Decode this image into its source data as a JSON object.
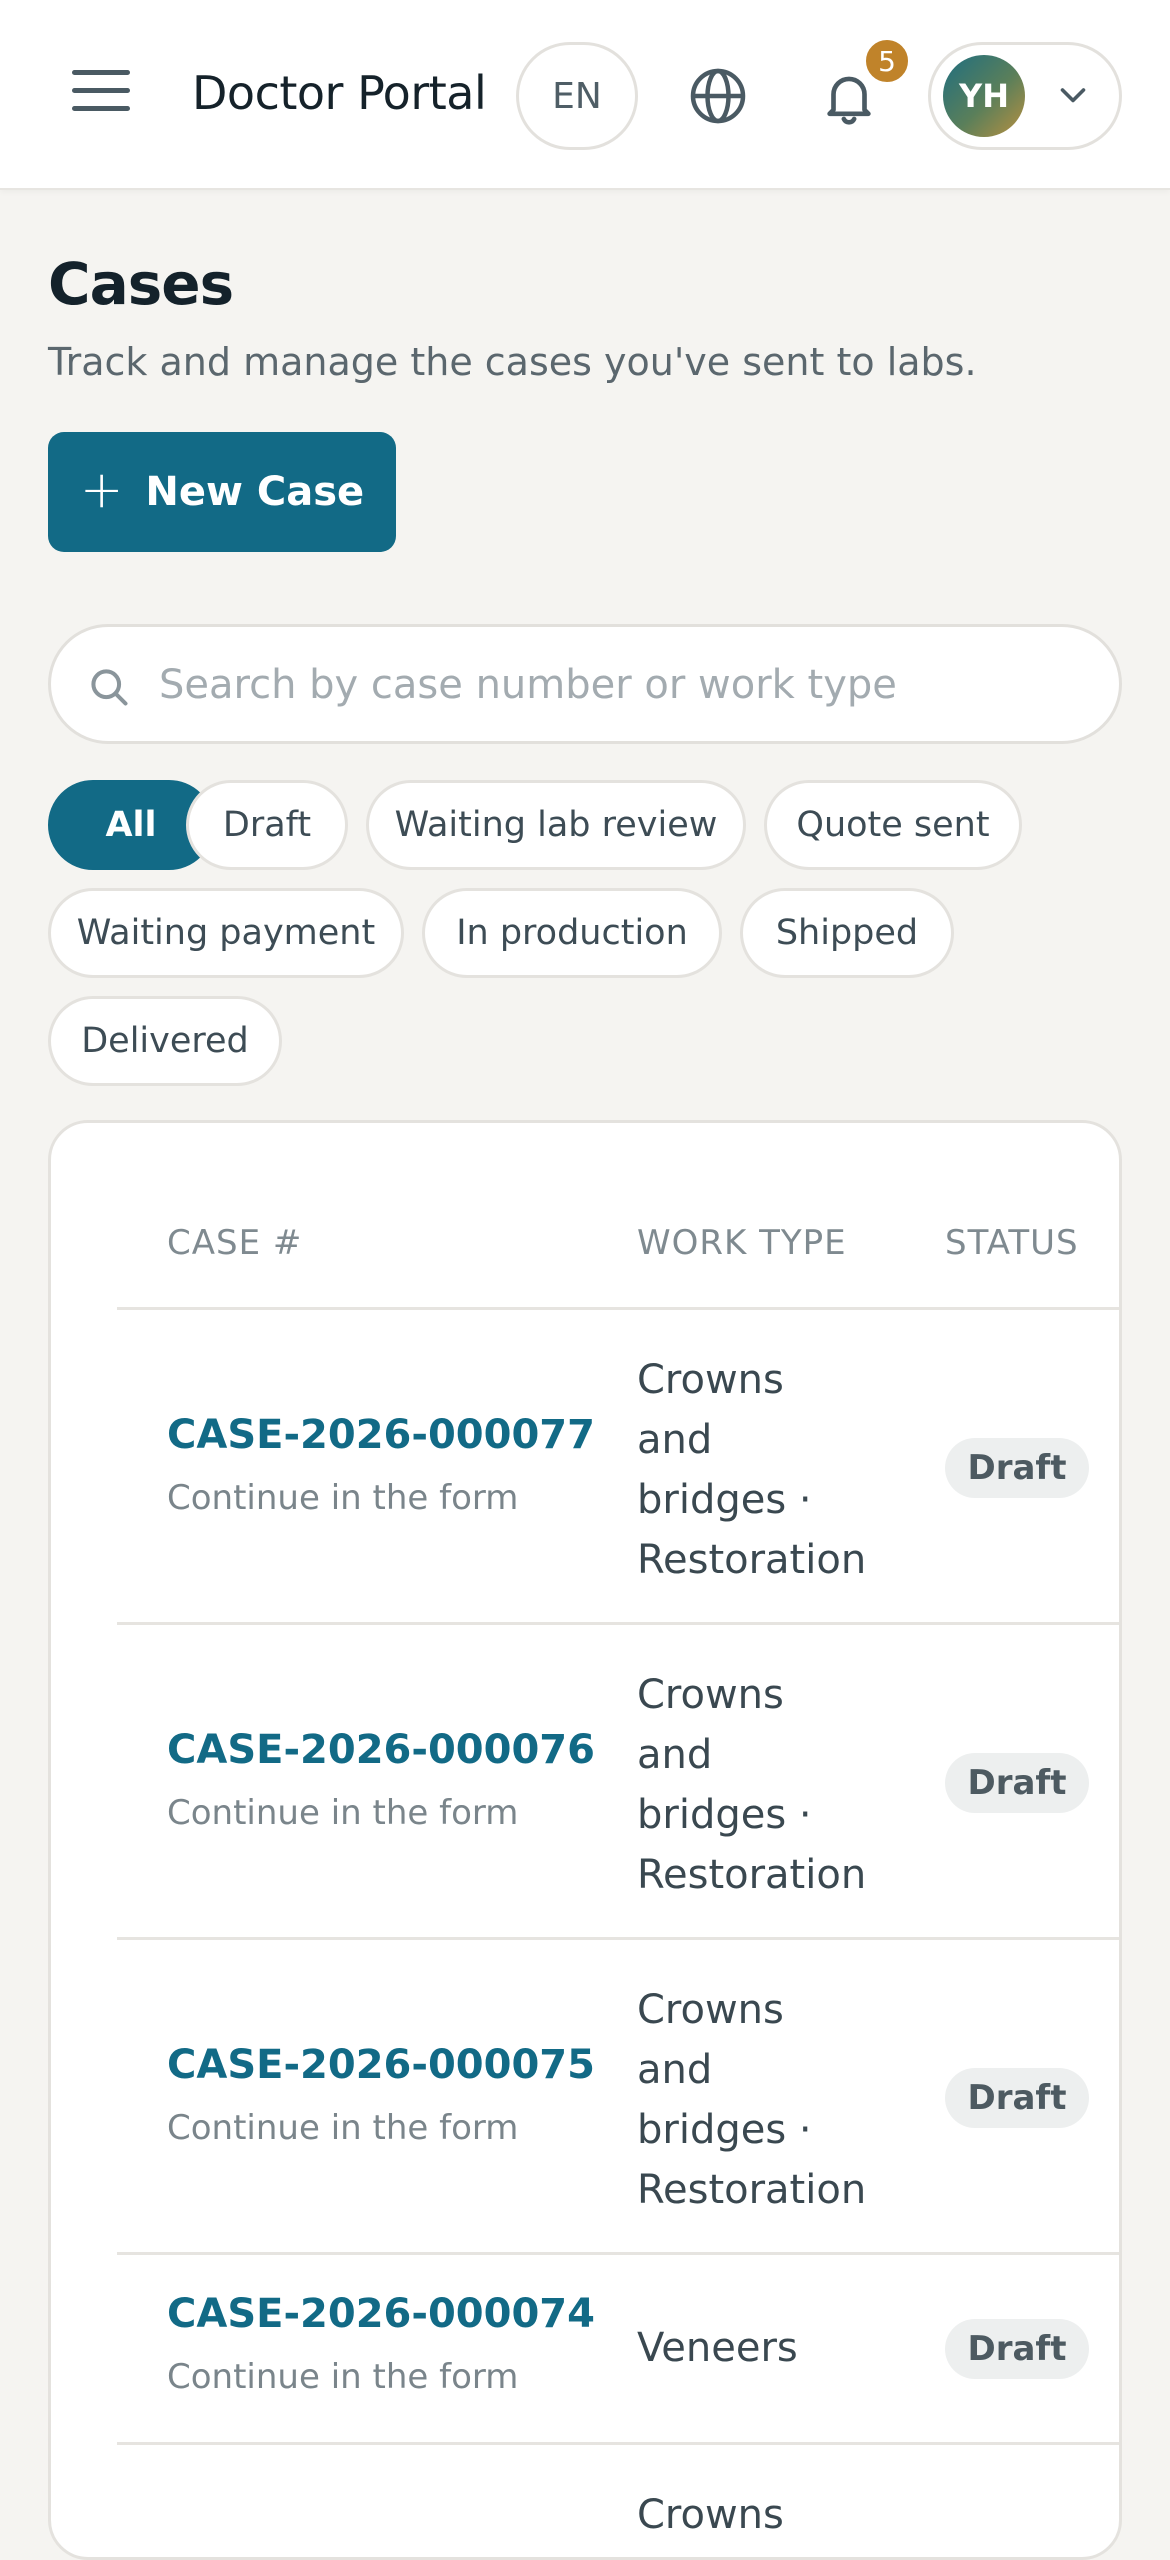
{
  "header": {
    "title": "Doctor Portal",
    "lang": "EN",
    "notifications_count": "5",
    "user_initials": "YH"
  },
  "page": {
    "title": "Cases",
    "subtitle": "Track and manage the cases you've sent to labs.",
    "new_case_label": "New Case"
  },
  "search": {
    "placeholder": "Search by case number or work type",
    "value": ""
  },
  "filters": [
    "All",
    "Draft",
    "Waiting lab review",
    "Quote sent",
    "Waiting payment",
    "In production",
    "Shipped",
    "Delivered"
  ],
  "active_filter": "All",
  "table": {
    "columns": [
      "CASE #",
      "WORK TYPE",
      "STATUS"
    ],
    "rows": [
      {
        "case": "CASE-2026-000077",
        "sub": "Continue in the form",
        "work": "Crowns and bridges · Restoration",
        "status": "Draft"
      },
      {
        "case": "CASE-2026-000076",
        "sub": "Continue in the form",
        "work": "Crowns and bridges · Restoration",
        "status": "Draft"
      },
      {
        "case": "CASE-2026-000075",
        "sub": "Continue in the form",
        "work": "Crowns and bridges · Restoration",
        "status": "Draft"
      },
      {
        "case": "CASE-2026-000074",
        "sub": "Continue in the form",
        "work": "Veneers",
        "status": "Draft"
      },
      {
        "case": "",
        "sub": "",
        "work": "Crowns",
        "status": ""
      }
    ]
  },
  "colors": {
    "primary": "#126a86",
    "badge_notification": "#c0832a",
    "background": "#f5f4f1"
  }
}
